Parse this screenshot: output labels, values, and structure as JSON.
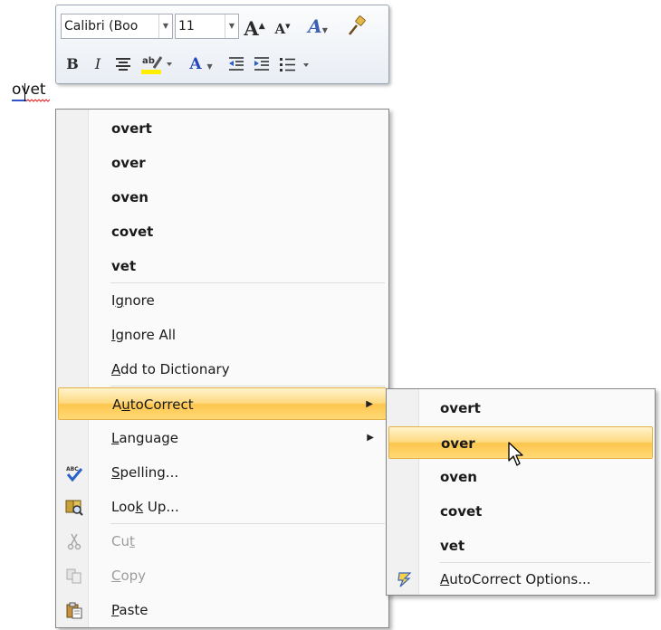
{
  "toolbar": {
    "font_name": "Calibri (Boo",
    "font_size": "11",
    "grow_font": "A",
    "shrink_font": "A",
    "styles": "A",
    "bold": "B",
    "italic": "I",
    "font_color": "A"
  },
  "document": {
    "word": "ovet"
  },
  "context_menu": {
    "suggestions": [
      "overt",
      "over",
      "oven",
      "covet",
      "vet"
    ],
    "ignore": {
      "pre": "I",
      "key": "g",
      "post": "nore"
    },
    "ignore_all": {
      "pre": "",
      "key": "I",
      "post": "gnore All"
    },
    "add_to_dictionary": {
      "pre": "",
      "key": "A",
      "post": "dd to Dictionary"
    },
    "autocorrect": {
      "pre": "A",
      "key": "u",
      "post": "toCorrect"
    },
    "language": {
      "pre": "",
      "key": "L",
      "post": "anguage"
    },
    "spelling": {
      "pre": "",
      "key": "S",
      "post": "pelling..."
    },
    "look_up": {
      "pre": "Loo",
      "key": "k",
      "post": " Up..."
    },
    "cut": {
      "pre": "Cu",
      "key": "t",
      "post": ""
    },
    "copy": {
      "pre": "",
      "key": "C",
      "post": "opy"
    },
    "paste": {
      "pre": "",
      "key": "P",
      "post": "aste"
    }
  },
  "autocorrect_submenu": {
    "items": [
      "overt",
      "over",
      "oven",
      "covet",
      "vet"
    ],
    "options": {
      "pre": "",
      "key": "A",
      "post": "utoCorrect Options..."
    }
  },
  "colors": {
    "highlight_top": "#fff3cd",
    "highlight_bottom": "#fdc64e",
    "highlight_border": "#e3b144",
    "menu_bg": "#fafafa",
    "disabled_text": "#9c9c9c"
  },
  "icons": {
    "spelling": "abc-check-icon",
    "look_up": "research-book-icon",
    "cut": "scissors-icon",
    "copy": "copy-icon",
    "paste": "clipboard-icon",
    "autocorrect_options": "lightning-icon"
  }
}
